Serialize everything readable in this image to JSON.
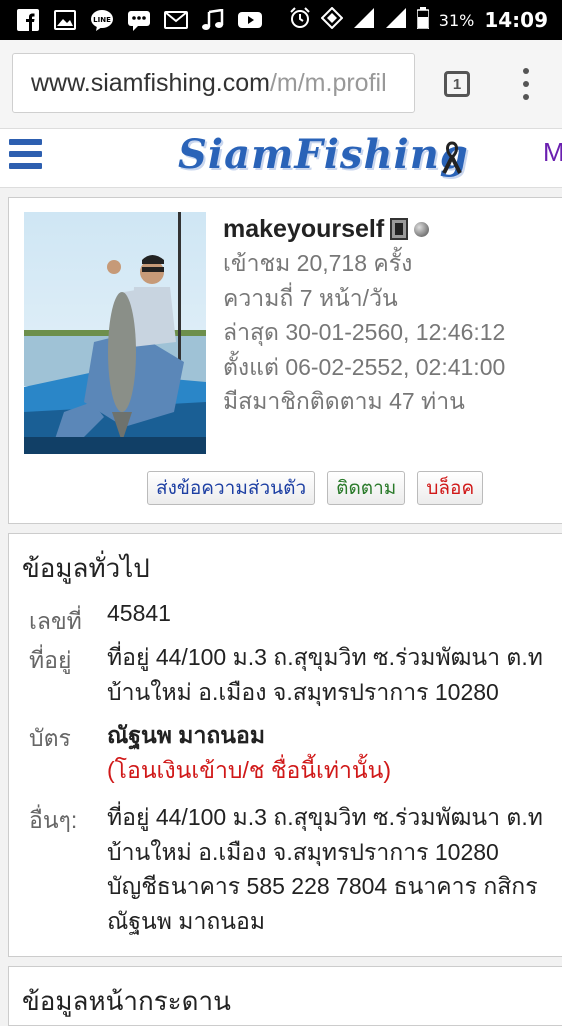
{
  "status_bar": {
    "battery": "31%",
    "time": "14:09",
    "icons": [
      "facebook-icon",
      "gallery-icon",
      "line-icon",
      "messenger-icon",
      "gmail-icon",
      "music-icon",
      "youtube-icon",
      "alarm-icon",
      "data-saver-icon",
      "signal-icon",
      "signal-icon-2",
      "battery-icon"
    ]
  },
  "browser": {
    "url_host": "www.siamfishing.com",
    "url_path": "/m/m.profil",
    "tab_count": "1"
  },
  "site": {
    "logo_text": "SiamFishing",
    "cut_text": "M"
  },
  "profile": {
    "username": "makeyourself",
    "views": "เข้าชม 20,718 ครั้ง",
    "frequency": "ความถี่ 7 หน้า/วัน",
    "last_seen": "ล่าสุด 30-01-2560, 12:46:12",
    "since": "ตั้งแต่ 06-02-2552, 02:41:00",
    "followers": "มีสมาชิกติดตาม 47 ท่าน",
    "buttons": {
      "message": "ส่งข้อความส่วนตัว",
      "follow": "ติดตาม",
      "block": "บล็อค"
    }
  },
  "general": {
    "title": "ข้อมูลทั่วไป",
    "id_label": "เลขที่",
    "id_value": "45841",
    "address_label": "ที่อยู่",
    "address_line1": "ที่อยู่ 44/100 ม.3 ถ.สุขุมวิท ซ.ร่วมพัฒนา ต.ท",
    "address_line2": "บ้านใหม่ อ.เมือง จ.สมุทรปราการ 10280",
    "card_label": "บัตร",
    "card_name": "ณัฐนพ มาถนอม",
    "card_note": "(โอนเงินเข้าบ/ช ชื่อนี้เท่านั้น)",
    "other_label": "อื่นๆ:",
    "other_line1": "ที่อยู่ 44/100 ม.3 ถ.สุขุมวิท ซ.ร่วมพัฒนา ต.ท",
    "other_line2": "บ้านใหม่ อ.เมือง จ.สมุทรปราการ 10280",
    "other_line3": "บัญชีธนาคาร 585 228 7804 ธนาคาร กสิกร",
    "other_line4": "ณัฐนพ มาถนอม"
  },
  "next_section": {
    "title": "ข้อมูลหน้ากระดาน"
  }
}
